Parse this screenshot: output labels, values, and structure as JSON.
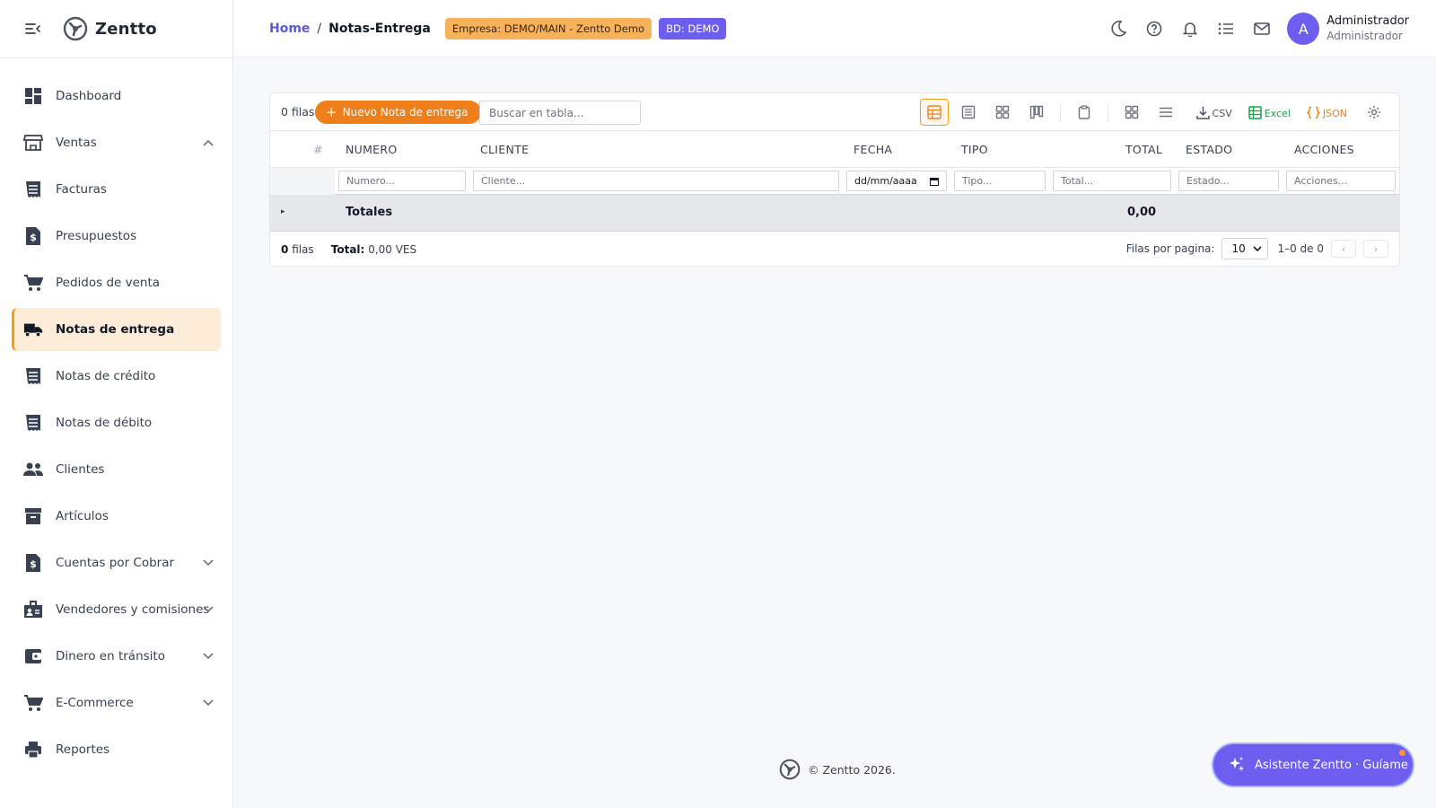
{
  "brand": {
    "name": "Zentto"
  },
  "sidebar": {
    "items": [
      {
        "label": "Dashboard",
        "icon": "dashboard-icon"
      },
      {
        "label": "Ventas",
        "icon": "store-icon",
        "expanded": true
      },
      {
        "label": "Facturas",
        "icon": "receipt-icon"
      },
      {
        "label": "Presupuestos",
        "icon": "quote-document-icon"
      },
      {
        "label": "Pedidos de venta",
        "icon": "cart-icon"
      },
      {
        "label": "Notas de entrega",
        "icon": "truck-icon",
        "active": true
      },
      {
        "label": "Notas de crédito",
        "icon": "receipt-icon"
      },
      {
        "label": "Notas de débito",
        "icon": "receipt-icon"
      },
      {
        "label": "Clientes",
        "icon": "people-icon"
      },
      {
        "label": "Artículos",
        "icon": "archive-icon"
      },
      {
        "label": "Cuentas por Cobrar",
        "icon": "quote-document-icon",
        "expandable": true
      },
      {
        "label": "Vendedores y comisiones",
        "icon": "badge-icon",
        "expandable": true
      },
      {
        "label": "Dinero en tránsito",
        "icon": "wallet-icon",
        "expandable": true
      },
      {
        "label": "E-Commerce",
        "icon": "cart-icon",
        "expandable": true
      },
      {
        "label": "Reportes",
        "icon": "printer-icon"
      }
    ]
  },
  "header": {
    "breadcrumb": {
      "home": "Home",
      "separator": "/",
      "current": "Notas-Entrega"
    },
    "badge_empresa": "Empresa: DEMO/MAIN - Zentto Demo",
    "badge_bd": "BD: DEMO",
    "user": {
      "initial": "A",
      "name": "Administrador",
      "role": "Administrador"
    }
  },
  "grid": {
    "row_count_label": "0 filas",
    "new_button": "Nuevo Nota de entrega",
    "search_placeholder": "Buscar en tabla...",
    "export": {
      "csv": "CSV",
      "excel": "Excel",
      "json": "JSON"
    },
    "columns": {
      "index": "#",
      "numero": "NUMERO",
      "cliente": "CLIENTE",
      "fecha": "FECHA",
      "tipo": "TIPO",
      "total": "TOTAL",
      "estado": "ESTADO",
      "acciones": "ACCIONES"
    },
    "filters": {
      "numero": "Numero...",
      "cliente": "Cliente...",
      "fecha": "dd/mm/aaaa",
      "tipo": "Tipo...",
      "total": "Total...",
      "estado": "Estado...",
      "acciones": "Acciones..."
    },
    "totals": {
      "expand_glyph": "▸",
      "label": "Totales",
      "value": "0,00"
    },
    "footer": {
      "count": "0",
      "count_label": "filas",
      "total_label": "Total:",
      "total_value": "0,00 VES",
      "rows_per_page_label": "Filas por pagina:",
      "rows_per_page": "10",
      "range": "1–0 de 0",
      "prev": "‹",
      "next": "›"
    }
  },
  "footer": {
    "copyright": "© Zentto 2026.",
    "assistant": "Asistente Zentto · Guíame"
  },
  "colors": {
    "accent": "#ef7f1a",
    "primary": "#6d5ef0",
    "active_bg": "#fdecd8",
    "badge_empresa": "#f8b25b"
  }
}
